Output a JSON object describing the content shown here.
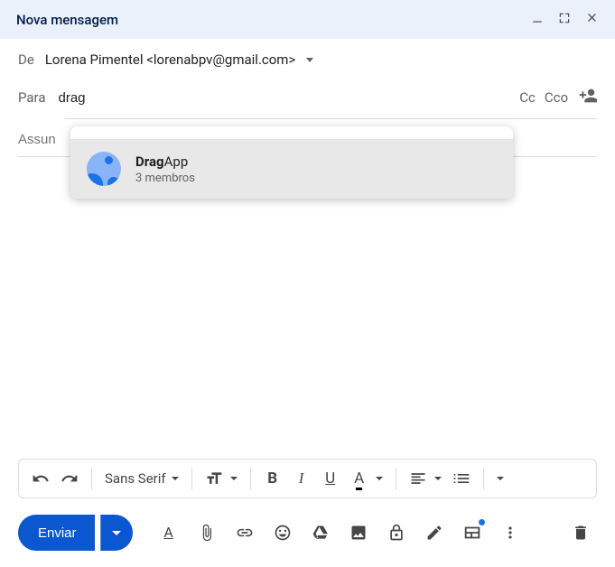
{
  "titlebar": {
    "title": "Nova mensagem"
  },
  "from": {
    "label": "De",
    "value": "Lorena Pimentel <lorenabpv@gmail.com>"
  },
  "to": {
    "label": "Para",
    "value": "drag",
    "cc": "Cc",
    "bcc": "Cco"
  },
  "subject": {
    "placeholder": "Assun"
  },
  "autocomplete": {
    "match": "Drag",
    "rest": "App",
    "subtitle": "3 membros"
  },
  "toolbar": {
    "font": "Sans Serif",
    "bold": "B",
    "italic": "I",
    "underline": "U",
    "color": "A"
  },
  "bottom": {
    "send": "Enviar",
    "format_a": "A"
  }
}
